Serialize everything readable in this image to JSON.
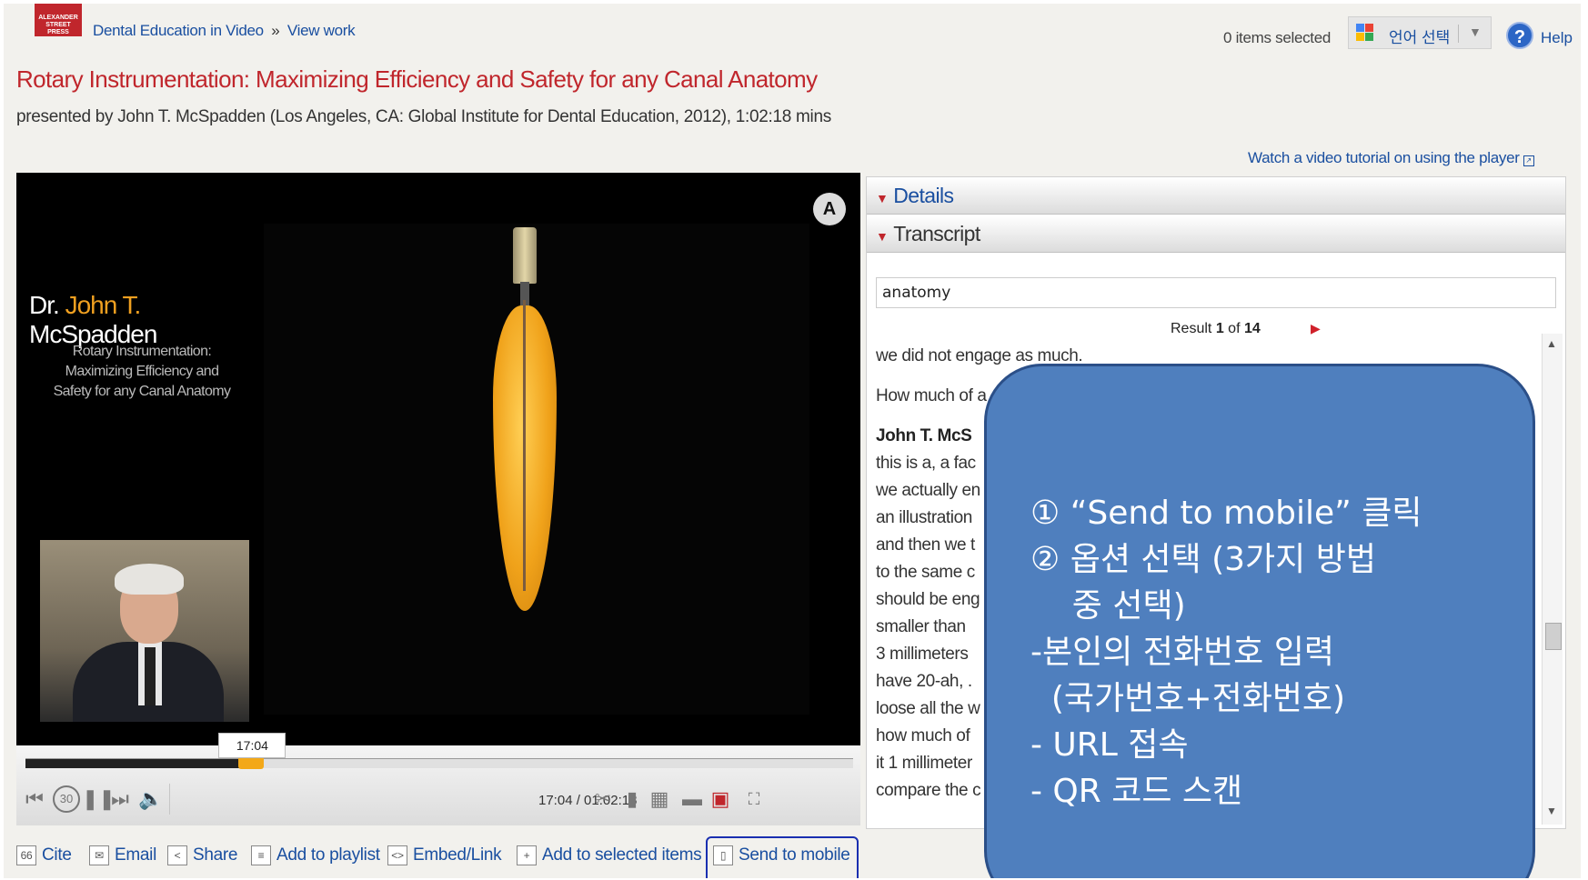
{
  "header": {
    "logo_text": "ALEXANDER STREET PRESS",
    "breadcrumb": {
      "collection": "Dental Education in Video",
      "separator": "»",
      "current": "View work"
    },
    "items_selected": "0 items selected",
    "language_select": "언어 선택",
    "help_label": "Help"
  },
  "work": {
    "title": "Rotary Instrumentation: Maximizing Efficiency and Safety for any Canal Anatomy",
    "byline": "presented by John T. McSpadden (Los Angeles, CA: Global Institute for Dental Education, 2012), 1:02:18 mins",
    "tutorial_link": "Watch a video tutorial on using the player"
  },
  "video": {
    "dr_prefix": "Dr. ",
    "dr_highlight": "John T.",
    "dr_suffix": " McSpadden",
    "subtitle_lines": [
      "Rotary Instrumentation:",
      "Maximizing Efficiency and",
      "Safety for any Canal Anatomy"
    ],
    "current_time_tip": "17:04",
    "time_display": "17:04 / 01:02:18",
    "progress_fraction": 0.273
  },
  "controls": {
    "rewind_icon": "rewind-icon",
    "skip_back_label": "30",
    "pause_icon": "pause-icon",
    "forward_icon": "fast-forward-icon",
    "volume_icon": "volume-icon",
    "clip_icon": "scissors-icon",
    "bookmark_icon": "bookmark-icon",
    "grid_icon": "grid-icon",
    "layout_icon": "layout-icon",
    "fullscreen_icon": "fullscreen-icon"
  },
  "actions": {
    "cite": "Cite",
    "email": "Email",
    "share": "Share",
    "add_to_playlist": "Add to playlist",
    "embed_link": "Embed/Link",
    "add_to_selected": "Add to selected items",
    "send_to_mobile": "Send to mobile"
  },
  "panel": {
    "details_label": "Details",
    "transcript_label": "Transcript",
    "search_value": "anatomy",
    "result_prefix": "Result",
    "result_current": "1",
    "result_of": "of",
    "result_total": "14",
    "transcript_lines": [
      "we did not engage as much.",
      "",
      "How much of a",
      "",
      "John T. McS",
      "this is a, a fac",
      "we actually en",
      "an illustration",
      "and then we t",
      "to the same c",
      "should be eng",
      "smaller than",
      "3 millimeters",
      "have 20-ah, .",
      "loose all the w",
      "how much of",
      "it 1 millimeter",
      "compare the c"
    ]
  },
  "callout": {
    "lines": [
      "① “Send to mobile” 클릭",
      "② 옵션 선택 (3가지 방법",
      "    중 선택)",
      "-본인의 전화번호 입력",
      "  (국가번호+전화번호)",
      "- URL 접속",
      "- QR 코드 스캔"
    ]
  },
  "colors": {
    "title_red": "#c0262c",
    "link_blue": "#1a4fa0",
    "callout_blue": "#4f7fbe",
    "highlight_box": "#1a2fb0",
    "progress_orange": "#f3a818"
  }
}
